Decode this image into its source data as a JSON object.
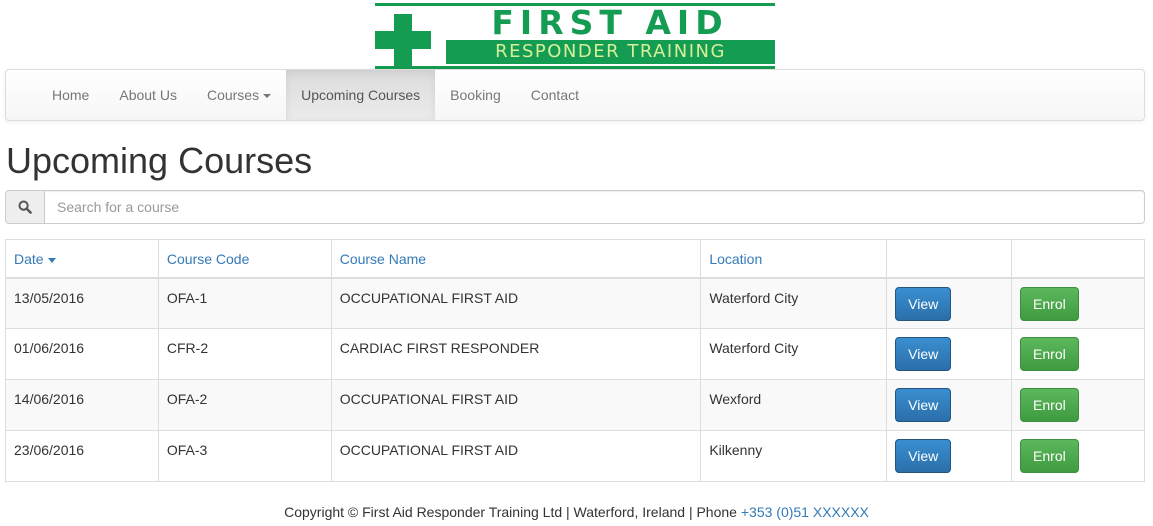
{
  "logo": {
    "title": "FIRST AID",
    "subtitle": "RESPONDER TRAINING",
    "color": "#139c52",
    "icon": "green-cross"
  },
  "nav": {
    "items": [
      {
        "label": "Home",
        "active": false
      },
      {
        "label": "About Us",
        "active": false
      },
      {
        "label": "Courses",
        "active": false,
        "dropdown": true
      },
      {
        "label": "Upcoming Courses",
        "active": true
      },
      {
        "label": "Booking",
        "active": false
      },
      {
        "label": "Contact",
        "active": false
      }
    ]
  },
  "page": {
    "title": "Upcoming Courses"
  },
  "search": {
    "icon": "search-icon",
    "placeholder": "Search for a course",
    "value": ""
  },
  "table": {
    "headers": {
      "date": "Date",
      "code": "Course Code",
      "name": "Course Name",
      "location": "Location"
    },
    "sorted_by": "date",
    "rows": [
      {
        "date": "13/05/2016",
        "code": "OFA-1",
        "name": "OCCUPATIONAL FIRST AID",
        "location": "Waterford City",
        "view": "View",
        "enrol": "Enrol"
      },
      {
        "date": "01/06/2016",
        "code": "CFR-2",
        "name": "CARDIAC FIRST RESPONDER",
        "location": "Waterford City",
        "view": "View",
        "enrol": "Enrol"
      },
      {
        "date": "14/06/2016",
        "code": "OFA-2",
        "name": "OCCUPATIONAL FIRST AID",
        "location": "Wexford",
        "view": "View",
        "enrol": "Enrol"
      },
      {
        "date": "23/06/2016",
        "code": "OFA-3",
        "name": "OCCUPATIONAL FIRST AID",
        "location": "Kilkenny",
        "view": "View",
        "enrol": "Enrol"
      }
    ]
  },
  "footer": {
    "text": "Copyright © First Aid Responder Training Ltd | Waterford, Ireland | Phone ",
    "phone": "+353 (0)51 XXXXXX"
  },
  "colors": {
    "link": "#337ab7",
    "view_button": "#337ab7",
    "enrol_button": "#5cb85c"
  }
}
